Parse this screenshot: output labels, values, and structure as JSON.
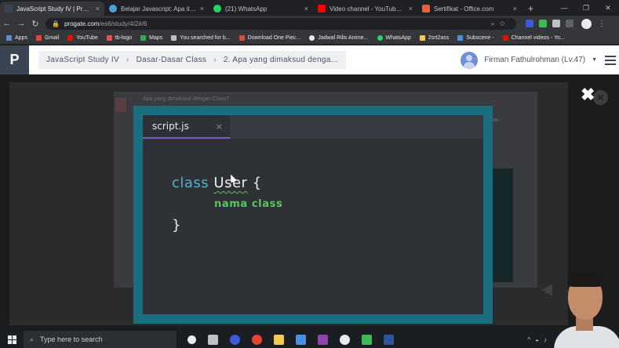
{
  "browser": {
    "tabs": [
      {
        "title": "JavaScript Study IV | Progate",
        "color": "#3a4452",
        "active": true
      },
      {
        "title": "Belajar Javascript: Apa itu Obje",
        "color": "#4aa3d8",
        "active": false
      },
      {
        "title": "(21) WhatsApp",
        "color": "#25d366",
        "active": false
      },
      {
        "title": "Video channel - YouTube Studi",
        "color": "#ff0000",
        "active": false
      },
      {
        "title": "Sertifikat - Office.com",
        "color": "#e8613a",
        "active": false
      }
    ],
    "tab_close": "×",
    "new_tab": "+",
    "window_controls": [
      "—",
      "❐",
      "✕"
    ],
    "url_host": "progate.com",
    "url_path": "/es6/study/4/2#/6",
    "bookmarks": [
      {
        "label": "Apps",
        "color": "#5f8ad8"
      },
      {
        "label": "Gmail",
        "color": "#ea4335"
      },
      {
        "label": "YouTube",
        "color": "#ff0000"
      },
      {
        "label": "tb-logo",
        "color": "#e05252"
      },
      {
        "label": "Maps",
        "color": "#34a853"
      },
      {
        "label": "You searched for b...",
        "color": "#bfbfbf"
      },
      {
        "label": "Download One Piec...",
        "color": "#d64f3a"
      },
      {
        "label": "Jadwal Rilis Anime...",
        "color": "#e8eaed"
      },
      {
        "label": "WhatsApp",
        "color": "#25d366"
      },
      {
        "label": "2srt2ass",
        "color": "#f2c94c"
      },
      {
        "label": "Subscene -",
        "color": "#4a90e2"
      },
      {
        "label": "Channel videos - Yo...",
        "color": "#ff0000"
      }
    ]
  },
  "header": {
    "logo": "P",
    "breadcrumb": [
      "JavaScript Study IV",
      "Dasar-Dasar Class",
      "2. Apa yang dimaksud denga..."
    ],
    "user_name": "Firman Fathulrohman (Lv.47)"
  },
  "background": {
    "question": "Apa yang dimaksud dengan Class?",
    "fragment": "an"
  },
  "editor": {
    "file_tab": "script.js",
    "close_glyph": "×",
    "code": {
      "keyword": "class",
      "class_name": "User",
      "open_brace": "{",
      "body": "nama class",
      "close_brace": "}"
    }
  },
  "modal_close": "✖",
  "taskbar": {
    "search_placeholder": "Type here to search",
    "icons": [
      "#e8eaed",
      "#bdc1c6",
      "#3b5bdb",
      "#e94235",
      "#f2c94c",
      "#4a90e2",
      "#8e44ad",
      "#e8eaed",
      "#3cba54",
      "#2b579a"
    ]
  }
}
